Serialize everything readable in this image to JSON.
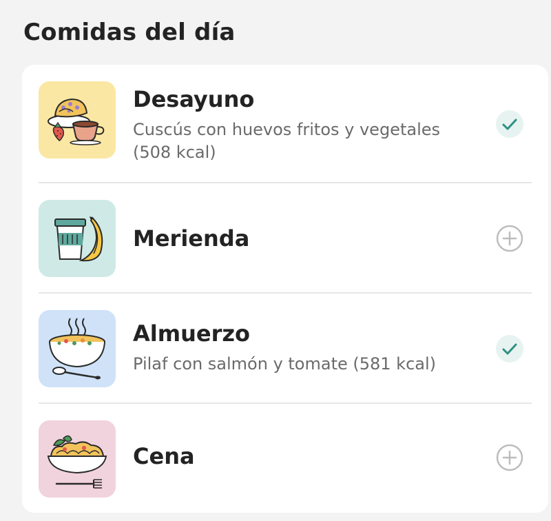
{
  "header": {
    "title": "Comidas del día"
  },
  "colors": {
    "check_bg": "#e6f3f1",
    "check_mark": "#2f8f83",
    "add_icon": "#bcbcbc",
    "breakfast_bg": "#fbe7a4",
    "snack_bg": "#cfeae6",
    "lunch_bg": "#cfe2f8",
    "dinner_bg": "#f1d3dd"
  },
  "meals": [
    {
      "name": "Desayuno",
      "description": "Cuscús con huevos fritos y vegetales (508 kcal)",
      "status": "completed",
      "icon": "breakfast-pastry-coffee-icon"
    },
    {
      "name": "Merienda",
      "description": "",
      "status": "add",
      "icon": "snack-cup-banana-icon"
    },
    {
      "name": "Almuerzo",
      "description": "Pilaf con salmón y tomate (581 kcal)",
      "status": "completed",
      "icon": "lunch-soup-bowl-icon"
    },
    {
      "name": "Cena",
      "description": "",
      "status": "add",
      "icon": "dinner-pasta-plate-icon"
    }
  ]
}
